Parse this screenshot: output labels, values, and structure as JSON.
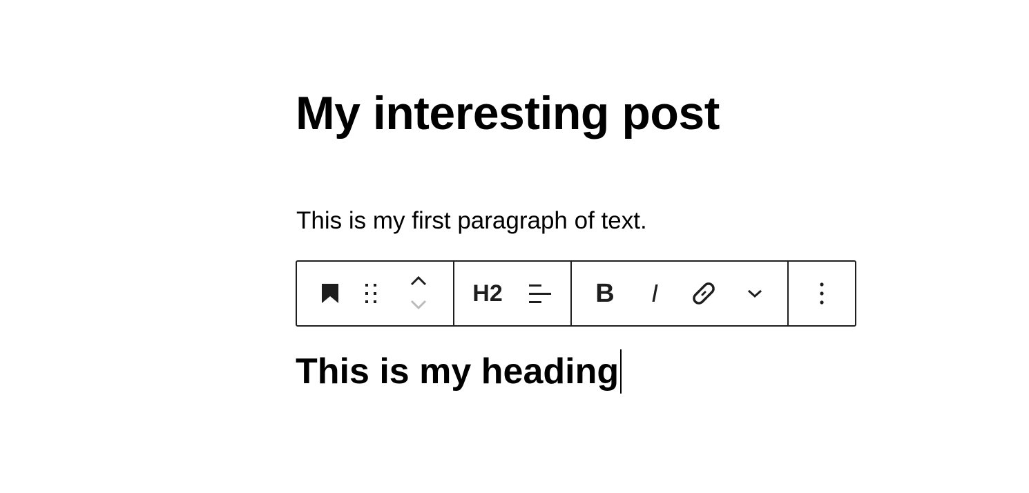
{
  "post": {
    "title": "My interesting post",
    "paragraph": "This is my first paragraph of text.",
    "heading": "This is my heading"
  },
  "toolbar": {
    "block_icon": "bookmark-icon",
    "drag_handle_icon": "drag-handle-icon",
    "move_up_icon": "chevron-up-icon",
    "move_down_icon": "chevron-down-icon",
    "heading_level_label": "H2",
    "align_icon": "align-left-icon",
    "bold_label": "B",
    "italic_label": "I",
    "link_icon": "link-icon",
    "more_formats_icon": "chevron-down-icon",
    "options_icon": "more-vertical-icon"
  },
  "colors": {
    "text": "#000000",
    "toolbar_icon": "#1e1e1e",
    "disabled_icon": "#bbbbbb",
    "border": "#1e1e1e"
  }
}
